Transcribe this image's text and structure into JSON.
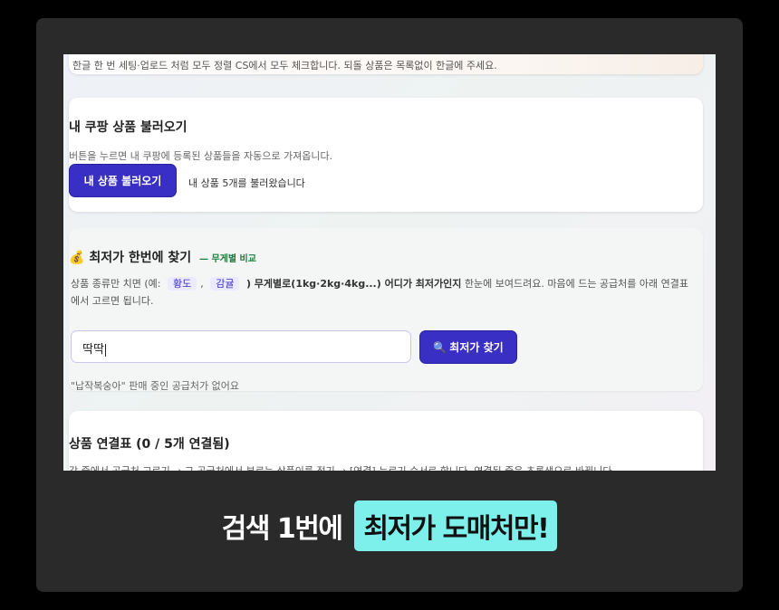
{
  "top_card": {
    "cut_text": "한글 한 번 세팅·업로드 처럼 모두 정렬 CS에서 모두 체크합니다. 되돌 상품은 목록없이 한글에 주세요."
  },
  "load_card": {
    "title": "내 쿠팡 상품 불러오기",
    "subtitle": "버튼을 누르면 내 쿠팡에 등록된 상품들을 자동으로 가져옵니다.",
    "button_label": "내 상품 불러오기",
    "status": "내 상품 5개를 불러왔습니다"
  },
  "find_card": {
    "icon_glyph": "💰",
    "title": "최저가 한번에 찾기",
    "badge": "— 무게별 비교",
    "desc_before": "상품 종류만 치면 (예:",
    "example_1": "황도",
    "example_sep": ",",
    "example_2": "감귤",
    "desc_after_bold": ") 무게별로(1kg·2kg·4kg...) 어디가 최저가인지",
    "desc_after": " 한눈에 보여드려요. 마음에 드는 공급처를 아래 연결표에서 고르면 됩니다.",
    "input_value": "딱딱",
    "search_icon_glyph": "🔍",
    "search_button_label": "최저가 찾기",
    "no_result": "\"납작복숭아\" 판매 중인 공급처가 없어요"
  },
  "link_card": {
    "title": "상품 연결표 (0 / 5개 연결됨)",
    "cut_text": "각 줄에서 공급처 고르기 → 그 공급처에서 부르는 상품이름 적기 → [연결] 누르기 순서로 합니다. 연결된 줄은 초록색으로 바뀝니다."
  },
  "caption": {
    "plain": "검색 1번에",
    "highlight": "최저가 도매처만!"
  },
  "colors": {
    "accent": "#3a2fc4",
    "highlight": "#7ef0ec",
    "frame": "#2a2a2a"
  }
}
